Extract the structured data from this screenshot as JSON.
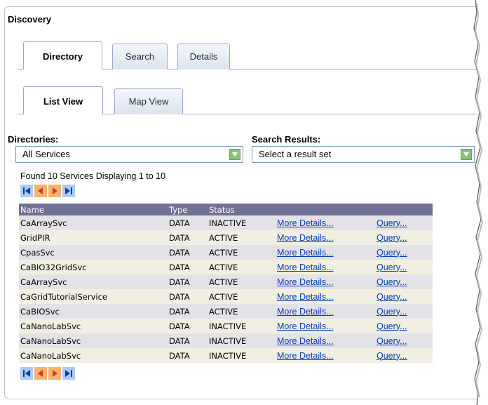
{
  "panel": {
    "title": "Discovery"
  },
  "main_tabs": [
    {
      "label": "Directory",
      "active": true
    },
    {
      "label": "Search",
      "active": false
    },
    {
      "label": "Details",
      "active": false
    }
  ],
  "view_tabs": [
    {
      "label": "List View",
      "active": true
    },
    {
      "label": "Map View",
      "active": false
    }
  ],
  "directories": {
    "label": "Directories:",
    "selected": "All Services"
  },
  "search_results": {
    "label": "Search Results:",
    "selected": "Select a result set"
  },
  "found_text": "Found 10 Services Displaying 1 to 10",
  "table": {
    "headers": [
      "Name",
      "Type",
      "Status",
      "",
      ""
    ],
    "rows": [
      {
        "name": "CaArraySvc",
        "type": "DATA",
        "status": "INACTIVE",
        "details": "More Details...",
        "query": "Query..."
      },
      {
        "name": "GridPIR",
        "type": "DATA",
        "status": "ACTIVE",
        "details": "More Details...",
        "query": "Query..."
      },
      {
        "name": "CpasSvc",
        "type": "DATA",
        "status": "ACTIVE",
        "details": "More Details...",
        "query": "Query..."
      },
      {
        "name": "CaBIO32GridSvc",
        "type": "DATA",
        "status": "ACTIVE",
        "details": "More Details...",
        "query": "Query..."
      },
      {
        "name": "CaArraySvc",
        "type": "DATA",
        "status": "ACTIVE",
        "details": "More Details...",
        "query": "Query..."
      },
      {
        "name": "CaGridTutorialService",
        "type": "DATA",
        "status": "ACTIVE",
        "details": "More Details...",
        "query": "Query..."
      },
      {
        "name": "CaBIOSvc",
        "type": "DATA",
        "status": "ACTIVE",
        "details": "More Details...",
        "query": "Query..."
      },
      {
        "name": "CaNanoLabSvc",
        "type": "DATA",
        "status": "INACTIVE",
        "details": "More Details...",
        "query": "Query..."
      },
      {
        "name": "CaNanoLabSvc",
        "type": "DATA",
        "status": "INACTIVE",
        "details": "More Details...",
        "query": "Query..."
      },
      {
        "name": "CaNanoLabSvc",
        "type": "DATA",
        "status": "INACTIVE",
        "details": "More Details...",
        "query": "Query..."
      }
    ]
  },
  "pager_icons": [
    "first-page-icon",
    "previous-page-icon",
    "next-page-icon",
    "last-page-icon"
  ],
  "colors": {
    "table_header": "#707195",
    "row_odd": "#e3e3e7",
    "row_even": "#f0efe2",
    "link": "#0b3bb5",
    "pager_blue": "#a9cdf2",
    "pager_orange": "#f6b26e",
    "dropdown_arrow": "#8ec17c"
  }
}
